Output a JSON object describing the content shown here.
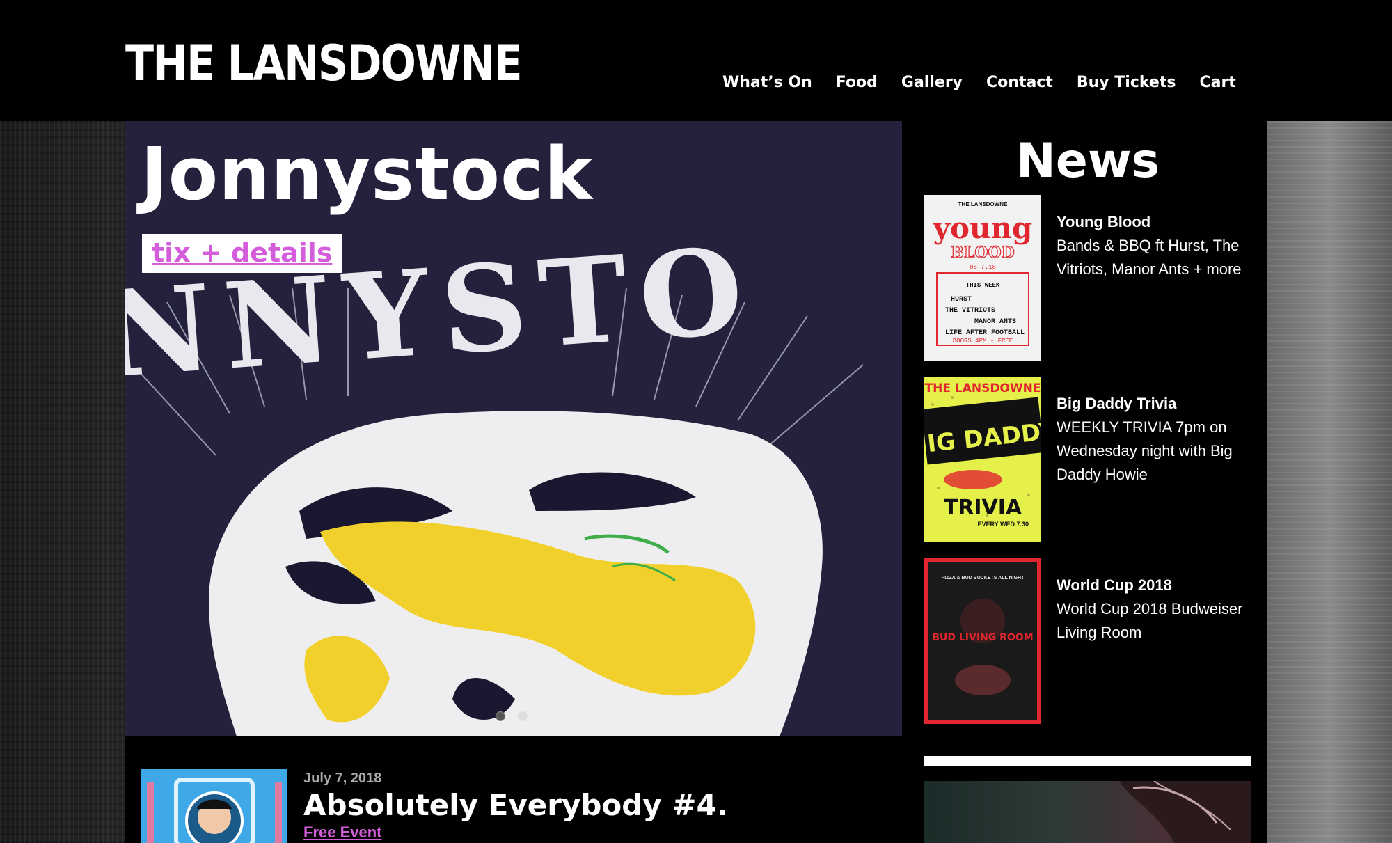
{
  "site": {
    "logo": "THE LANSDOWNE"
  },
  "nav": [
    {
      "label": "What’s On"
    },
    {
      "label": "Food"
    },
    {
      "label": "Gallery"
    },
    {
      "label": "Contact"
    },
    {
      "label": "Buy Tickets"
    },
    {
      "label": "Cart"
    }
  ],
  "hero": {
    "title": "Jonnystock",
    "button_label": "tix + details",
    "artwork_text": "NNYSTO",
    "slides": 2,
    "active_slide": 2
  },
  "event": {
    "date": "July 7, 2018",
    "title": "Absolutely Everybody #4.",
    "tag": "Free Event"
  },
  "news": {
    "heading": "News",
    "items": [
      {
        "title": "Young Blood",
        "description": "Bands & BBQ ft Hurst, The Vitriots, Manor Ants + more",
        "poster": {
          "header": "THE LANSDOWNE",
          "title": "young",
          "subtitle": "BLOOD",
          "date": "08.7.18",
          "week": "THIS WEEK",
          "lineup": [
            "HURST",
            "THE VITRIOTS",
            "MANOR ANTS",
            "LIFE AFTER FOOTBALL"
          ],
          "footer": "DOORS 4PM - FREE"
        }
      },
      {
        "title": "Big Daddy Trivia",
        "description": "WEEKLY TRIVIA 7pm on Wednesday night with Big Daddy Howie",
        "poster": {
          "header": "THE LANSDOWNE",
          "title": "BIG DADDY",
          "subtitle": "TRIVIA",
          "footer": "EVERY WED 7.30"
        }
      },
      {
        "title": "World Cup 2018",
        "description": "World Cup 2018 Budweiser Living Room",
        "poster": {
          "header": "PIZZA & BUD BUCKETS ALL NIGHT",
          "title": "BUD LIVING ROOM"
        }
      }
    ]
  },
  "colors": {
    "accent": "#d45ddb",
    "black": "#000000",
    "white": "#ffffff",
    "hero_bg": "#23213b",
    "hero_yellow": "#f2d02c",
    "poster_red": "#e0262f",
    "poster_yellow": "#e6f04a"
  }
}
